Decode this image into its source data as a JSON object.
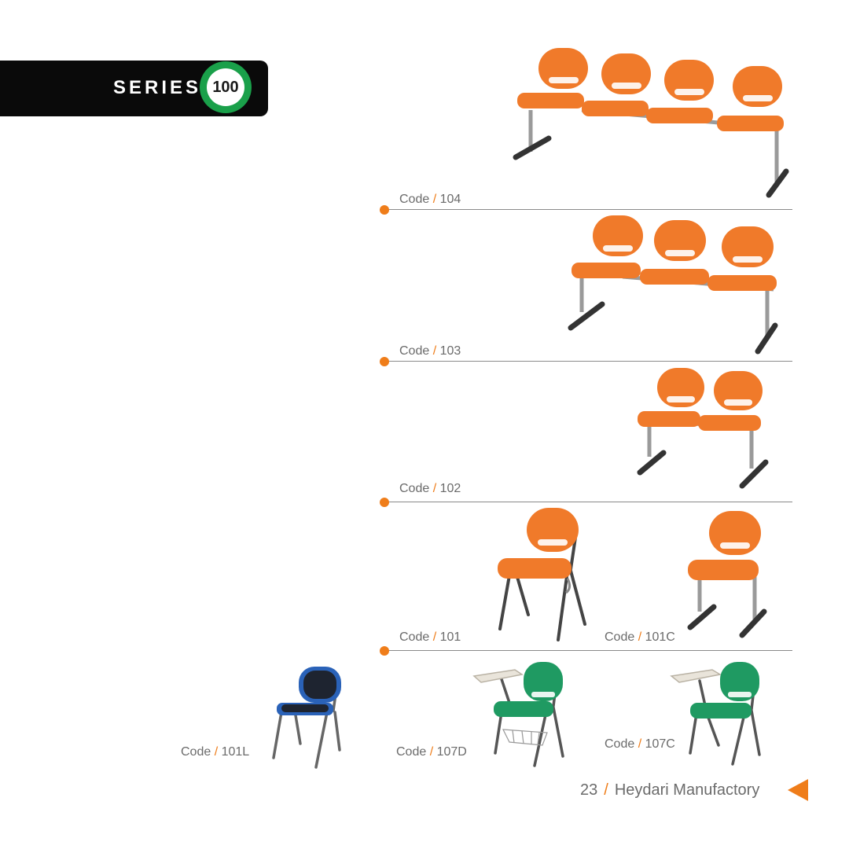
{
  "header": {
    "series_label": "SERIES",
    "series_number": "100"
  },
  "products": [
    {
      "code_prefix": "Code",
      "slash": "/",
      "code": "104"
    },
    {
      "code_prefix": "Code",
      "slash": "/",
      "code": "103"
    },
    {
      "code_prefix": "Code",
      "slash": "/",
      "code": "102"
    },
    {
      "code_prefix": "Code",
      "slash": "/",
      "code": "101"
    },
    {
      "code_prefix": "Code",
      "slash": "/",
      "code": "101C"
    },
    {
      "code_prefix": "Code",
      "slash": "/",
      "code": "101L"
    },
    {
      "code_prefix": "Code",
      "slash": "/",
      "code": "107D"
    },
    {
      "code_prefix": "Code",
      "slash": "/",
      "code": "107C"
    }
  ],
  "footer": {
    "page_number": "23",
    "slash": "/",
    "company": "Heydari Manufactory"
  },
  "colors": {
    "accent": "#ef7d1a",
    "badge_green": "#1aa04a",
    "seat_orange": "#f07a2a",
    "seat_green": "#1f9a62",
    "seat_blue": "#2a62b8",
    "banner": "#0a0a0a"
  },
  "icons": {
    "footer_arrow": "triangle-left-icon"
  }
}
